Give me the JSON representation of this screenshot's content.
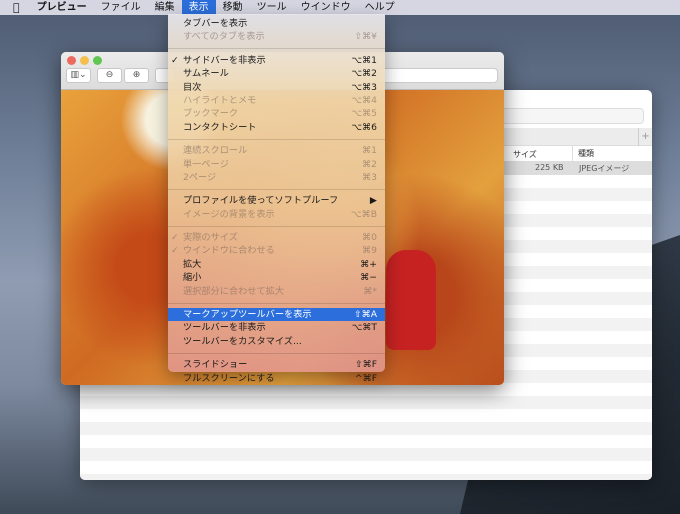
{
  "menubar": {
    "apple": "",
    "items": [
      "プレビュー",
      "ファイル",
      "編集",
      "表示",
      "移動",
      "ツール",
      "ウインドウ",
      "ヘルプ"
    ],
    "active_index": 3
  },
  "view_menu": {
    "groups": [
      [
        {
          "label": "タブバーを表示",
          "shortcut": "",
          "enabled": true
        },
        {
          "label": "すべてのタブを表示",
          "shortcut": "⇧⌘¥",
          "enabled": false
        }
      ],
      [
        {
          "label": "サイドバーを非表示",
          "shortcut": "⌥⌘1",
          "enabled": true,
          "checked": true
        },
        {
          "label": "サムネール",
          "shortcut": "⌥⌘2",
          "enabled": true
        },
        {
          "label": "目次",
          "shortcut": "⌥⌘3",
          "enabled": true
        },
        {
          "label": "ハイライトとメモ",
          "shortcut": "⌥⌘4",
          "enabled": false
        },
        {
          "label": "ブックマーク",
          "shortcut": "⌥⌘5",
          "enabled": false
        },
        {
          "label": "コンタクトシート",
          "shortcut": "⌥⌘6",
          "enabled": true
        }
      ],
      [
        {
          "label": "連続スクロール",
          "shortcut": "⌘1",
          "enabled": false
        },
        {
          "label": "単一ページ",
          "shortcut": "⌘2",
          "enabled": false
        },
        {
          "label": "2ページ",
          "shortcut": "⌘3",
          "enabled": false
        }
      ],
      [
        {
          "label": "プロファイルを使ってソフトプルーフ",
          "shortcut": "▶",
          "enabled": true
        },
        {
          "label": "イメージの背景を表示",
          "shortcut": "⌥⌘B",
          "enabled": false
        }
      ],
      [
        {
          "label": "実際のサイズ",
          "shortcut": "⌘0",
          "enabled": false,
          "checked": true
        },
        {
          "label": "ウインドウに合わせる",
          "shortcut": "⌘9",
          "enabled": false,
          "checked": true
        },
        {
          "label": "拡大",
          "shortcut": "⌘+",
          "enabled": true
        },
        {
          "label": "縮小",
          "shortcut": "⌘−",
          "enabled": true
        },
        {
          "label": "選択部分に合わせて拡大",
          "shortcut": "⌘*",
          "enabled": false
        }
      ],
      [
        {
          "label": "マークアップツールバーを表示",
          "shortcut": "⇧⌘A",
          "enabled": true,
          "highlighted": true
        },
        {
          "label": "ツールバーを非表示",
          "shortcut": "⌥⌘T",
          "enabled": true
        },
        {
          "label": "ツールバーをカスタマイズ...",
          "shortcut": "",
          "enabled": true
        }
      ],
      [
        {
          "label": "スライドショー",
          "shortcut": "⇧⌘F",
          "enabled": true
        },
        {
          "label": "フルスクリーンにする",
          "shortcut": "^⌘F",
          "enabled": true
        }
      ]
    ]
  },
  "back_window": {
    "plus": "+",
    "columns": {
      "size": "サイズ",
      "kind": "種類"
    },
    "row": {
      "size": "225 KB",
      "kind": "JPEGイメージ"
    }
  },
  "preview_window": {
    "sidebar_btn": "▥⌄",
    "zoom_out": "⊖",
    "zoom_in": "⊕"
  },
  "colors": {
    "highlight": "#2c6fdc"
  }
}
